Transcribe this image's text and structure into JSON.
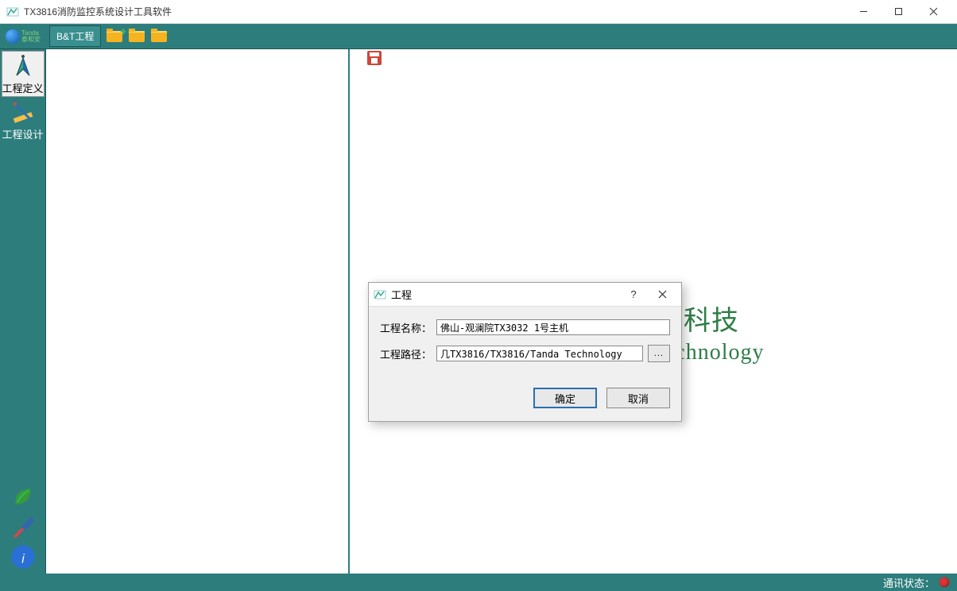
{
  "window": {
    "title": "TX3816消防监控系统设计工具软件"
  },
  "topmenu": {
    "project": "B&T工程"
  },
  "sidebar": {
    "define": "工程定义",
    "design": "工程设计"
  },
  "watermark": {
    "line1": "和安科技",
    "line2": "la Technology"
  },
  "dialog": {
    "title": "工程",
    "name_label": "工程名称：",
    "name_value": "佛山-观澜院TX3032 1号主机",
    "path_label": "工程路径：",
    "path_value": "几TX3816/TX3816/Tanda Technology",
    "browse": "...",
    "ok": "确定",
    "cancel": "取消"
  },
  "statusbar": {
    "comm_label": "通讯状态："
  }
}
